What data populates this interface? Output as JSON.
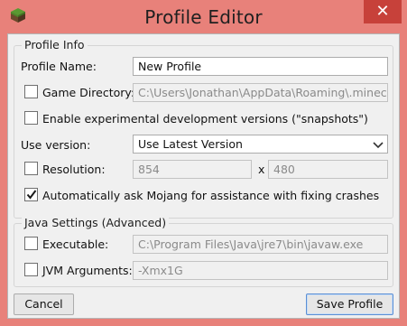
{
  "window": {
    "title": "Profile Editor",
    "close_glyph": "✕"
  },
  "profile_info": {
    "legend": "Profile Info",
    "profile_name_label": "Profile Name:",
    "profile_name_value": "New Profile",
    "game_directory_label": "Game Directory:",
    "game_directory_value": "C:\\Users\\Jonathan\\AppData\\Roaming\\.minecraft",
    "game_directory_checked": false,
    "snapshots_label": "Enable experimental development versions (\"snapshots\")",
    "snapshots_checked": false,
    "use_version_label": "Use version:",
    "use_version_value": "Use Latest Version",
    "resolution_label": "Resolution:",
    "resolution_checked": false,
    "resolution_width": "854",
    "resolution_separator": "x",
    "resolution_height": "480",
    "mojang_label": "Automatically ask Mojang for assistance with fixing crashes",
    "mojang_checked": true
  },
  "java_settings": {
    "legend": "Java Settings (Advanced)",
    "executable_label": "Executable:",
    "executable_checked": false,
    "executable_value": "C:\\Program Files\\Java\\jre7\\bin\\javaw.exe",
    "jvm_args_label": "JVM Arguments:",
    "jvm_args_checked": false,
    "jvm_args_value": "-Xmx1G"
  },
  "buttons": {
    "cancel": "Cancel",
    "save": "Save Profile"
  },
  "colors": {
    "titlebar": "#e8817a",
    "close_button": "#c7413a",
    "client_bg": "#f0f0f0"
  },
  "icons": {
    "app": "minecraft-grass-block-icon",
    "dropdown": "chevron-down-icon",
    "check": "checkmark-icon"
  }
}
